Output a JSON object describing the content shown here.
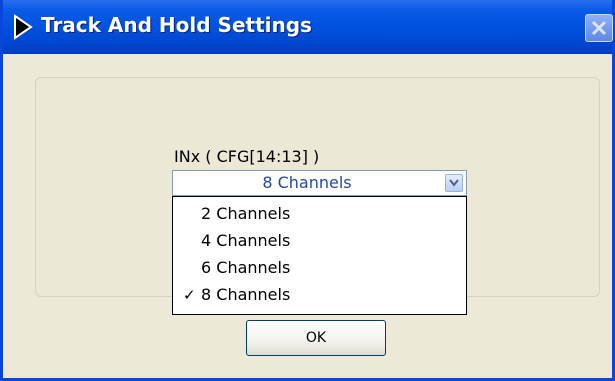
{
  "window": {
    "title": "Track And Hold Settings"
  },
  "form": {
    "inx_label": "INx ( CFG[14:13] )",
    "inx_selected": "8 Channels",
    "inx_options": [
      {
        "label": "2 Channels",
        "checked": false
      },
      {
        "label": "4 Channels",
        "checked": false
      },
      {
        "label": "6 Channels",
        "checked": false
      },
      {
        "label": "8 Channels",
        "checked": true
      }
    ],
    "check_mark": "✓"
  },
  "buttons": {
    "ok_label": "OK"
  },
  "colors": {
    "titlebar": "#0052df",
    "dialog_bg": "#ece9d8",
    "selected_text": "#2248a8"
  },
  "icons": {
    "app": "play-triangle-icon",
    "close": "close-icon",
    "dropdown": "chevron-down-icon"
  }
}
